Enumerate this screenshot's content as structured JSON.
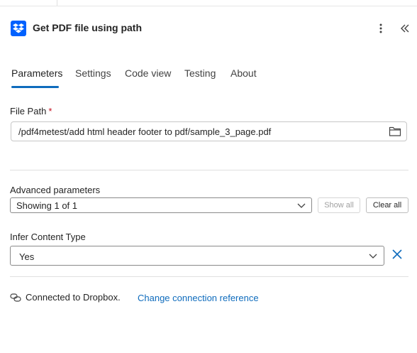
{
  "header": {
    "title": "Get PDF file using path",
    "logo_icon": "dropbox-icon",
    "more_icon": "more-vertical-icon",
    "collapse_icon": "double-chevron-left-icon",
    "brand_color": "#0061fe"
  },
  "tabs": [
    {
      "label": "Parameters",
      "active": true
    },
    {
      "label": "Settings",
      "active": false
    },
    {
      "label": "Code view",
      "active": false
    },
    {
      "label": "Testing",
      "active": false
    },
    {
      "label": "About",
      "active": false
    }
  ],
  "file_path": {
    "label": "File Path",
    "required_mark": "*",
    "value": "/pdf4metest/add html header footer to pdf/sample_3_page.pdf",
    "picker_icon": "folder-icon"
  },
  "advanced": {
    "label": "Advanced parameters",
    "selected": "Showing 1 of 1",
    "show_all_label": "Show all",
    "clear_all_label": "Clear all"
  },
  "infer_content_type": {
    "label": "Infer Content Type",
    "selected": "Yes",
    "clear_icon": "close-icon"
  },
  "connection": {
    "icon": "link-icon",
    "status": "Connected to Dropbox.",
    "change_link": "Change connection reference"
  },
  "colors": {
    "accent": "#0f6cbd",
    "required": "#c50f1f"
  }
}
